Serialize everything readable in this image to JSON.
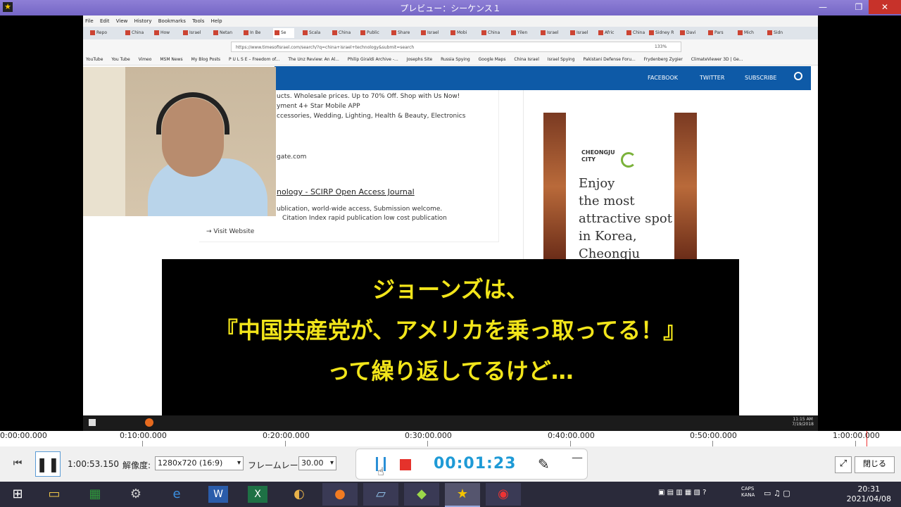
{
  "window": {
    "title": "プレビュー：シーケンス１",
    "minimize": "—",
    "maximize": "❐",
    "close": "✕"
  },
  "browser": {
    "menu": [
      "File",
      "Edit",
      "View",
      "History",
      "Bookmarks",
      "Tools",
      "Help"
    ],
    "tabs": [
      "Repo",
      "China",
      "How",
      "Israel",
      "Netan",
      "In Be",
      "Se",
      "Scala",
      "China",
      "Public",
      "Share",
      "Israel",
      "Mobi",
      "China",
      "Yilen",
      "Israel",
      "Israel",
      "Afric",
      "China",
      "Sidney R",
      "Davi",
      "Pars",
      "Mich",
      "Sidn"
    ],
    "url": "https://www.timesofisrael.com/search/?q=china+israel+technology&submit=search",
    "zoom": "133%",
    "bookmarks": [
      "YouTube",
      "You Tube",
      "Vimeo",
      "MSM News",
      "My Blog Posts",
      "P U L S E – Freedom of...",
      "The Unz Review: An Al...",
      "Philip Giraldi Archive -...",
      "Josephs Site",
      "Russia Spying",
      "Google Maps",
      "China Israel",
      "Israel Spying",
      "Pakistani Defense Foru...",
      "Frydenberg Zygier",
      "ClimateViewer 3D | Ge..."
    ]
  },
  "site": {
    "facebook": "FACEBOOK",
    "twitter": "TWITTER",
    "subscribe": "SUBSCRIBE"
  },
  "ad": {
    "line1": "ucts. Wholesale prices. Up to 70% Off. Shop with Us Now!",
    "line2": "yment   4+ Star Mobile APP",
    "line3": "ccessories, Wedding, Lighting, Health & Beauty, Electronics",
    "domain": "gate.com",
    "heading": "nology - SCIRP Open Access Journal",
    "line4": "ublication, world-wide access, Submission welcome.",
    "line5": "Citation Index   rapid publication   low cost publication",
    "visit": "Visit Website"
  },
  "side_ad": {
    "brand": "CHEONGJU\nCITY",
    "text": "Enjoy\nthe most\nattractive spot\nin Korea,\nCheongju"
  },
  "inner_clock": {
    "time": "11:15 AM",
    "date": "7/19/2018"
  },
  "subtitle": {
    "line1": "ジョーンズは、",
    "line2": "『中国共産党が、アメリカを乗っ取ってる！』",
    "line3": "って繰り返してるけど…"
  },
  "timeline": {
    "ticks": [
      "0:00:00.000",
      "0:10:00.000",
      "0:20:00.000",
      "0:30:00.000",
      "0:40:00.000",
      "0:50:00.000",
      "1:00:00.000"
    ],
    "playhead_fraction": 0.9681
  },
  "controls": {
    "position": "1:00:53.150",
    "resolution_label": "解像度:",
    "resolution_value": "1280x720 (16:9)",
    "framerate_label": "フレームレート:",
    "framerate_value": "30.00",
    "close_label": "閉じる"
  },
  "recorder": {
    "elapsed": "00:01:23",
    "minimize": "—"
  },
  "taskbar": {
    "time": "20:31",
    "date": "2021/04/08",
    "caps": "CAPS",
    "kana": "KANA"
  }
}
